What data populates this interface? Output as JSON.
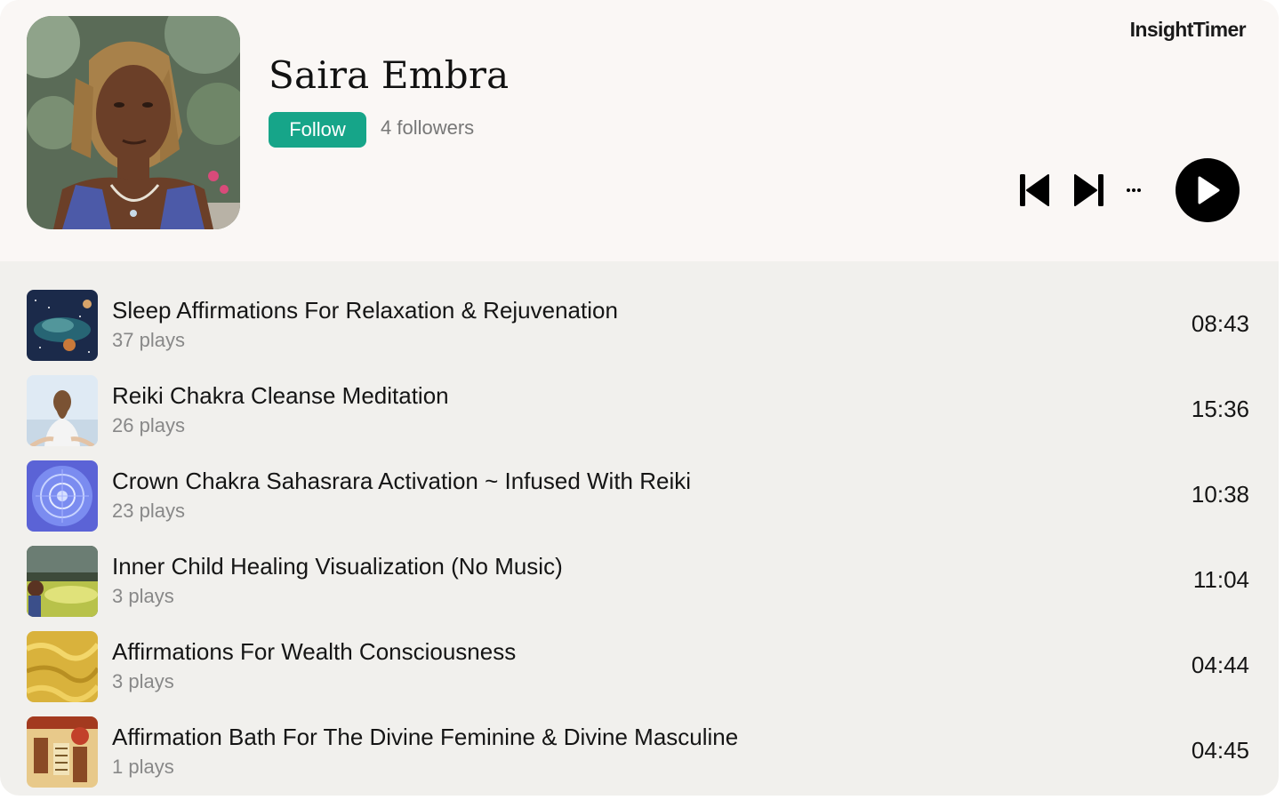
{
  "brand": "InsightTimer",
  "artist": {
    "name": "Saira Embra",
    "follow_label": "Follow",
    "followers_text": "4 followers"
  },
  "player": {
    "prev_icon": "skip-back-icon",
    "next_icon": "skip-forward-icon",
    "more_icon": "ellipsis-icon",
    "more_label": "···",
    "play_icon": "play-icon"
  },
  "colors": {
    "accent": "#16a589",
    "header_bg": "#faf7f5",
    "list_bg": "#f1f0ed"
  },
  "tracks": [
    {
      "title": "Sleep Affirmations For Relaxation & Rejuvenation",
      "plays": "37 plays",
      "duration": "08:43",
      "thumb": "space-galaxy"
    },
    {
      "title": "Reiki Chakra Cleanse Meditation",
      "plays": "26 plays",
      "duration": "15:36",
      "thumb": "meditating-woman"
    },
    {
      "title": "Crown Chakra Sahasrara Activation ~ Infused With Reiki",
      "plays": "23 plays",
      "duration": "10:38",
      "thumb": "blue-mandala"
    },
    {
      "title": "Inner Child Healing Visualization (No Music)",
      "plays": "3 plays",
      "duration": "11:04",
      "thumb": "child-in-field"
    },
    {
      "title": "Affirmations For Wealth Consciousness",
      "plays": "3 plays",
      "duration": "04:44",
      "thumb": "gold-texture"
    },
    {
      "title": "Affirmation Bath For The Divine Feminine & Divine Masculine",
      "plays": "1 plays",
      "duration": "04:45",
      "thumb": "egyptian-art"
    }
  ]
}
